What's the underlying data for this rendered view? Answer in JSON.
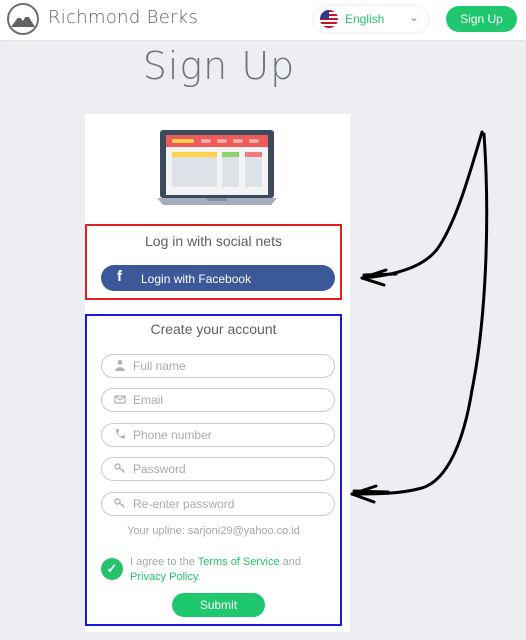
{
  "header": {
    "brand": "Richmond Berks",
    "language": {
      "selected": "English"
    },
    "signup_label": "Sign Up"
  },
  "page": {
    "title": "Sign Up"
  },
  "social": {
    "title": "Log in with social nets",
    "facebook_label": "Login with Facebook"
  },
  "form": {
    "title": "Create your account",
    "fields": [
      {
        "placeholder": "Full name",
        "icon": "user-icon"
      },
      {
        "placeholder": "Email",
        "icon": "envelope-icon"
      },
      {
        "placeholder": "Phone number",
        "icon": "phone-icon"
      },
      {
        "placeholder": "Password",
        "icon": "key-icon"
      },
      {
        "placeholder": "Re-enter password",
        "icon": "key-icon"
      }
    ],
    "upline": "Your upline: sarjoni29@yahoo.co.id",
    "agree_prefix": "I agree to the ",
    "terms_label": "Terms of Service",
    "agree_middle": " and",
    "privacy_label": "Privacy Policy",
    "agree_suffix": ".",
    "agree_checked": true,
    "submit_label": "Submit"
  },
  "colors": {
    "accent_green": "#1fc86f",
    "facebook_blue": "#3b5998",
    "social_outline_red": "#e0201f",
    "form_outline_blue": "#1b1be0"
  }
}
